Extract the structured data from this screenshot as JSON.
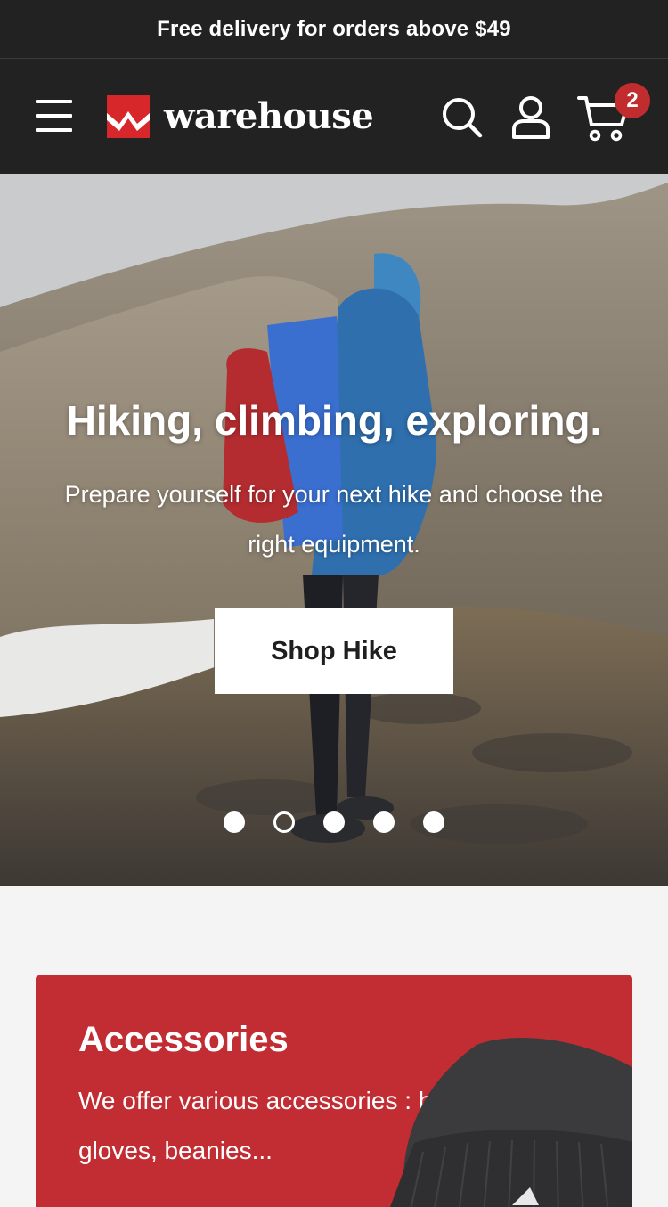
{
  "announcement": {
    "text": "Free delivery for orders above $49"
  },
  "header": {
    "menu_icon": "hamburger-menu-icon",
    "logo_text": "warehouse",
    "search_icon": "search-icon",
    "account_icon": "user-account-icon",
    "cart_icon": "shopping-cart-icon",
    "cart_count": "2"
  },
  "hero": {
    "title": "Hiking, climbing, exploring.",
    "subtitle": "Prepare yourself for your next hike and choose the right equipment.",
    "button_label": "Shop Hike",
    "slide_count": 5,
    "active_slide": 2
  },
  "promo": {
    "title": "Accessories",
    "text": "We offer various accessories :  hats, gloves, beanies..."
  },
  "colors": {
    "header_bg": "#232222",
    "brand_red": "#c12d2f",
    "promo_bg": "#c12d33",
    "page_bg": "#f4f4f4"
  }
}
